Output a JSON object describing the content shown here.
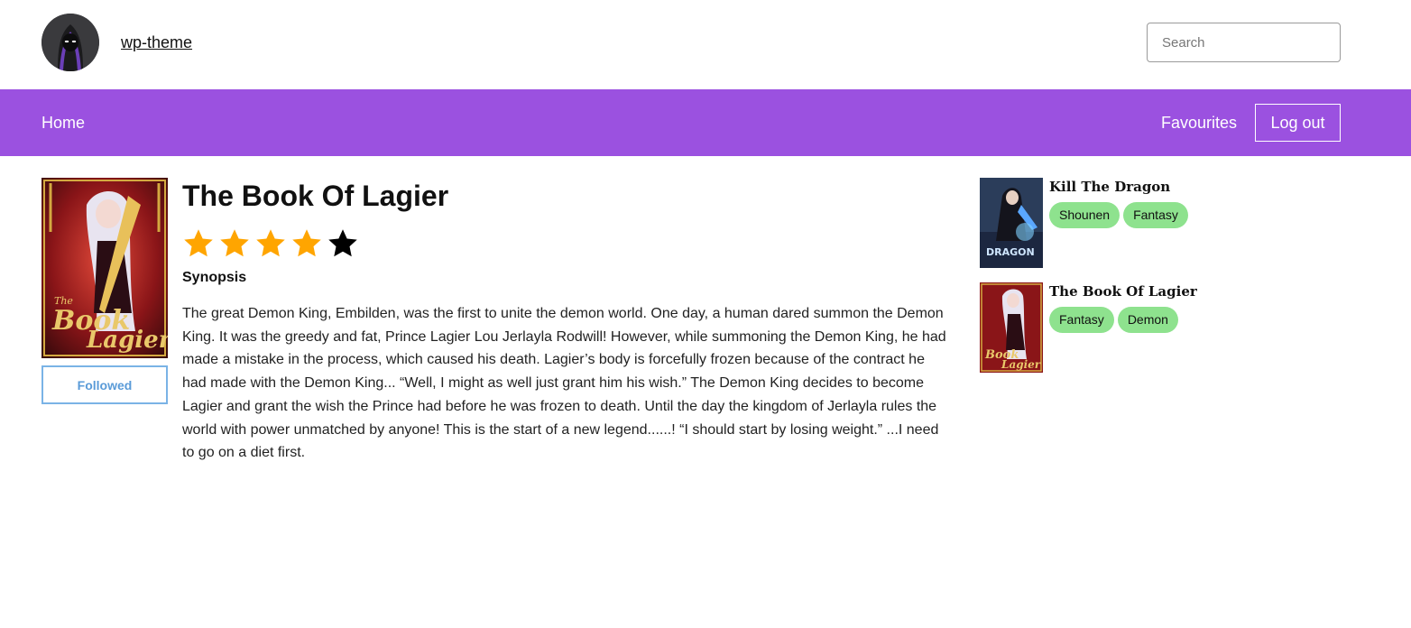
{
  "header": {
    "site_name": "wp-theme",
    "search_placeholder": "Search"
  },
  "nav": {
    "home": "Home",
    "favourites": "Favourites",
    "logout": "Log out"
  },
  "colors": {
    "nav_bg": "#9b51e0",
    "star_filled": "#ffa500",
    "star_empty": "#000000",
    "tag_bg": "#8ee28e",
    "follow_border": "#7ab3e6"
  },
  "book": {
    "title": "The Book Of Lagier",
    "rating": 4,
    "rating_max": 5,
    "follow_label": "Followed",
    "synopsis_label": "Synopsis",
    "synopsis": "The great Demon King, Embilden, was the first to unite the demon world. One day, a human dared summon the Demon King. It was the greedy and fat, Prince Lagier Lou Jerlayla Rodwill! However, while summoning the Demon King, he had made a mistake in the process, which caused his death. Lagier’s body is forcefully frozen because of the contract he had made with the Demon King... “Well, I might as well just grant him his wish.” The Demon King decides to become Lagier and grant the wish the Prince had before he was frozen to death. Until the day the kingdom of Jerlayla rules the world with power unmatched by anyone! This is the start of a new legend......! “I should start by losing weight.” ...I need to go on a diet first."
  },
  "sidebar": {
    "items": [
      {
        "title": "Kill The Dragon",
        "tags": [
          "Shounen",
          "Fantasy"
        ]
      },
      {
        "title": "The Book Of Lagier",
        "tags": [
          "Fantasy",
          "Demon"
        ]
      }
    ]
  }
}
